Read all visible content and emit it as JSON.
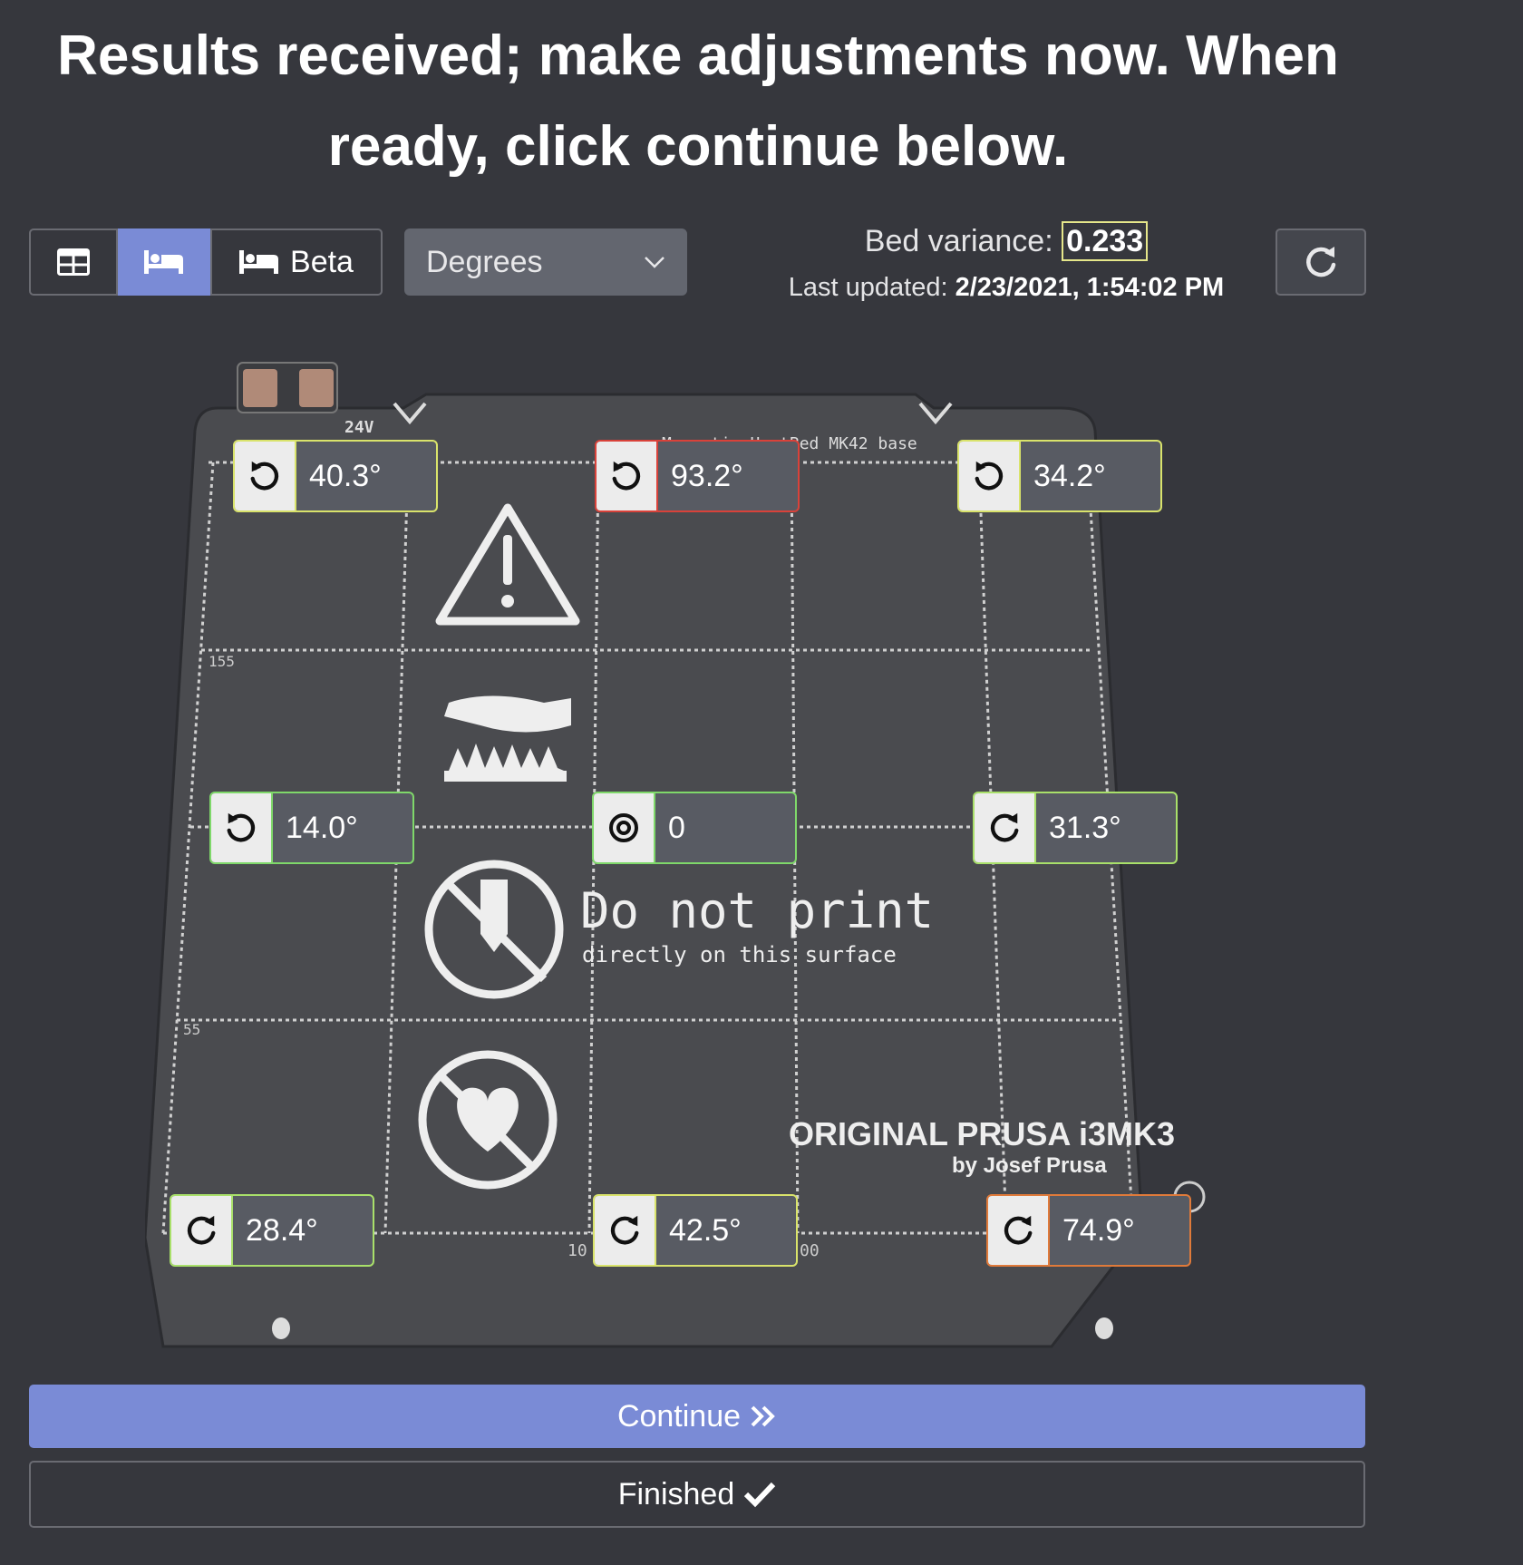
{
  "header": {
    "title_line1": "Results received; make adjustments now. When",
    "title_line2": "ready, click continue below."
  },
  "toolbar": {
    "view_buttons": [
      {
        "icon": "table-icon",
        "active": false
      },
      {
        "icon": "bed-icon",
        "active": true
      },
      {
        "icon": "bed-icon",
        "label": "Beta",
        "active": false
      }
    ],
    "unit_select": {
      "value": "Degrees"
    },
    "refresh_icon": "redo-icon"
  },
  "info": {
    "variance_label": "Bed variance:",
    "variance_value": "0.233",
    "updated_label": "Last updated:",
    "updated_value": "2/23/2021, 1:54:02 PM"
  },
  "bed": {
    "plate_text": {
      "voltage": "24V",
      "heatbed": "Magnetic HeatBed MK42 base",
      "do_not_print": "Do not print",
      "do_not_print_sub": "directly on this surface",
      "brand": "ORIGINAL PRUSA i3MK3",
      "brand_sub": "by Josef Prusa",
      "ruler_155": "155",
      "ruler_55": "55",
      "ruler_10": "10",
      "ruler_0": "0",
      "ruler_00": "00"
    },
    "probes": [
      {
        "value": "40.3°",
        "direction": "counterclockwise",
        "status_color": "#d9e36b"
      },
      {
        "value": "93.2°",
        "direction": "counterclockwise",
        "status_color": "#d9423a"
      },
      {
        "value": "34.2°",
        "direction": "counterclockwise",
        "status_color": "#d9e36b"
      },
      {
        "value": "14.0°",
        "direction": "counterclockwise",
        "status_color": "#7fd86a"
      },
      {
        "value": "0",
        "direction": "center",
        "status_color": "#7fd86a"
      },
      {
        "value": "31.3°",
        "direction": "clockwise",
        "status_color": "#a9e06a"
      },
      {
        "value": "28.4°",
        "direction": "clockwise",
        "status_color": "#a9e06a"
      },
      {
        "value": "42.5°",
        "direction": "clockwise",
        "status_color": "#d9e36b"
      },
      {
        "value": "74.9°",
        "direction": "clockwise",
        "status_color": "#e07a3a"
      }
    ]
  },
  "actions": {
    "continue_label": "Continue",
    "finished_label": "Finished"
  },
  "colors": {
    "background": "#36373d",
    "accent": "#7a8bd6"
  }
}
